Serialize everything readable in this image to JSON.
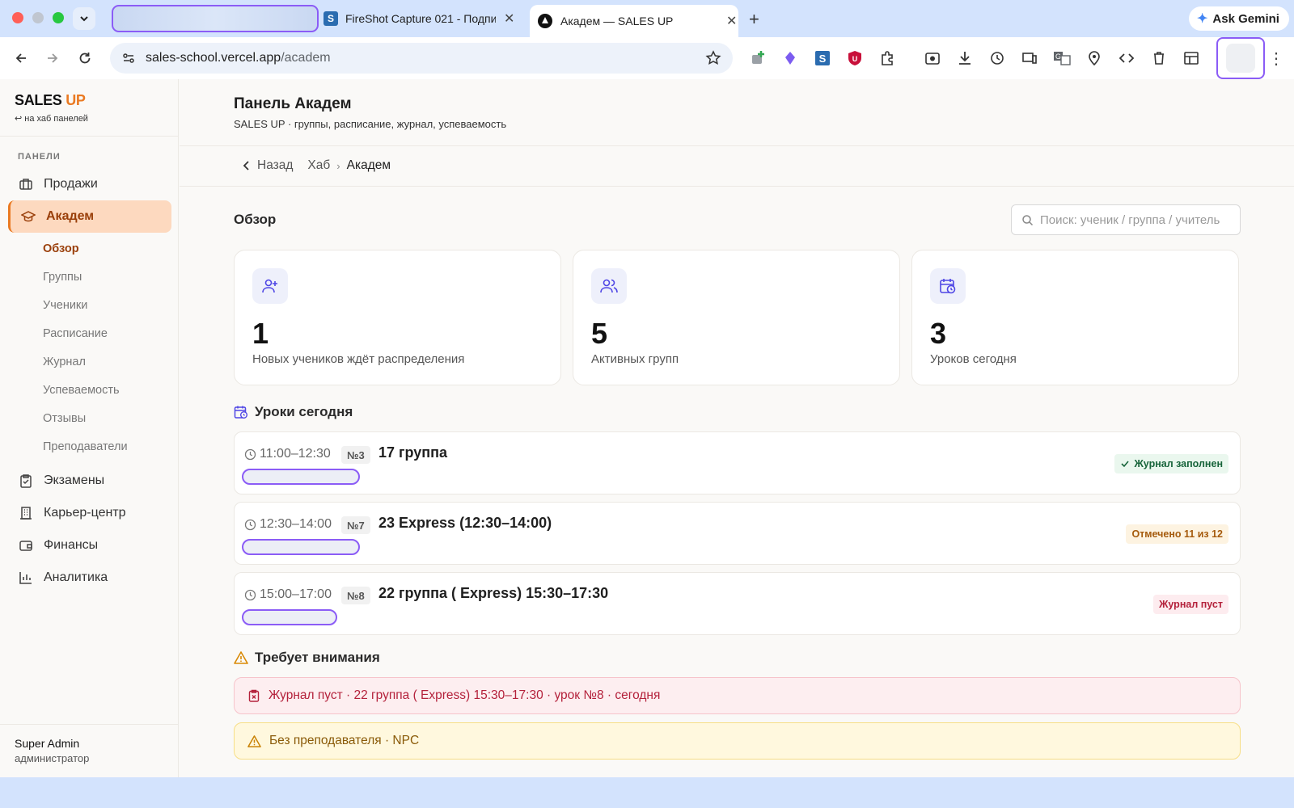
{
  "browser": {
    "tabs": [
      {
        "label": "FireShot Capture 021 - Подпи..."
      },
      {
        "label": "Академ — SALES UP"
      }
    ],
    "ask_gemini": "Ask Gemini",
    "url_host": "sales-school.vercel.app",
    "url_path": "/academ"
  },
  "sidebar": {
    "brand_sales": "SALES",
    "brand_up": "UP",
    "back_hub": "↩ на хаб панелей",
    "section": "ПАНЕЛИ",
    "items": [
      {
        "label": "Продажи",
        "icon": "briefcase-icon"
      },
      {
        "label": "Академ",
        "icon": "graduation-cap-icon"
      },
      {
        "label": "Экзамены",
        "icon": "clipboard-check-icon"
      },
      {
        "label": "Карьер-центр",
        "icon": "building-icon"
      },
      {
        "label": "Финансы",
        "icon": "wallet-icon"
      },
      {
        "label": "Аналитика",
        "icon": "bar-chart-icon"
      }
    ],
    "subitems": [
      "Обзор",
      "Группы",
      "Ученики",
      "Расписание",
      "Журнал",
      "Успеваемость",
      "Отзывы",
      "Преподаватели"
    ],
    "user_name": "Super Admin",
    "user_role": "администратор"
  },
  "header": {
    "title": "Панель Академ",
    "subtitle": "SALES UP · группы, расписание, журнал, успеваемость"
  },
  "breadcrumb": {
    "back": "Назад",
    "hub": "Хаб",
    "current": "Академ"
  },
  "overview": {
    "title": "Обзор",
    "search_placeholder": "Поиск: ученик / группа / учитель",
    "cards": [
      {
        "value": "1",
        "label": "Новых учеников ждёт распределения",
        "icon": "user-plus-icon"
      },
      {
        "value": "5",
        "label": "Активных групп",
        "icon": "users-icon"
      },
      {
        "value": "3",
        "label": "Уроков сегодня",
        "icon": "calendar-clock-icon"
      }
    ]
  },
  "lessons": {
    "title": "Уроки сегодня",
    "items": [
      {
        "time": "11:00–12:30",
        "number": "№3",
        "group": "17 группа",
        "status": "Журнал заполнен",
        "status_type": "ok"
      },
      {
        "time": "12:30–14:00",
        "number": "№7",
        "group": "23 Express (12:30–14:00)",
        "status": "Отмечено 11 из 12",
        "status_type": "warn"
      },
      {
        "time": "15:00–17:00",
        "number": "№8",
        "group": "22 группа ( Express) 15:30–17:30",
        "status": "Журнал пуст",
        "status_type": "bad"
      }
    ]
  },
  "attention": {
    "title": "Требует внимания",
    "alerts": [
      {
        "text": "Журнал пуст · 22 группа ( Express) 15:30–17:30 · урок №8 · сегодня",
        "type": "error"
      },
      {
        "text": "Без преподавателя · NPC",
        "type": "warning"
      }
    ]
  },
  "colors": {
    "accent": "#ea7a22",
    "active_bg": "#fdd9bf",
    "icon_accent": "#4f46e5"
  }
}
